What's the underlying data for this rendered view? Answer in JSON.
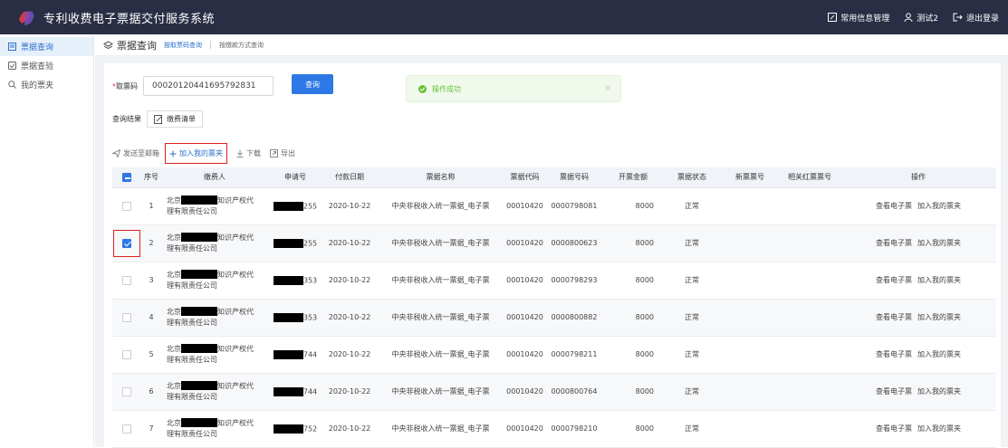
{
  "app": {
    "title": "专利收费电子票据交付服务系统"
  },
  "topnav": {
    "info_mgmt": "常用信息管理",
    "user": "测试2",
    "logout": "退出登录"
  },
  "sidebar": {
    "items": [
      {
        "label": "票据查询"
      },
      {
        "label": "票据查验"
      },
      {
        "label": "我的票夹"
      }
    ]
  },
  "tabs": {
    "title": "票据查询",
    "tab1": "按取票码查询",
    "sep": "|",
    "tab2": "按缴款方式查询"
  },
  "form": {
    "label": "取票码",
    "required_mark": "*",
    "code_value": "00020120441695792831",
    "query_button": "查询"
  },
  "toast": {
    "message": "操作成功",
    "close": "×"
  },
  "result": {
    "label": "查询结果",
    "tab": "缴费清单"
  },
  "toolbar": {
    "send_email": "发送至邮箱",
    "add_to_folder": "加入我的票夹",
    "download": "下载",
    "export": "导出"
  },
  "table": {
    "headers": [
      "序号",
      "缴费人",
      "申请号",
      "付款日期",
      "票据名称",
      "票据代码",
      "票据号码",
      "开票金额",
      "票据状态",
      "新票票号",
      "相关红票票号",
      "操作"
    ],
    "rows": [
      {
        "no": "1",
        "payer_prefix": "北京",
        "payer_suffix": "知识产权代",
        "payer_line2": "理有限责任公司",
        "app_suffix": "255",
        "date": "2020-10-22",
        "name": "中央非税收入统一票据_电子票",
        "code": "00010420",
        "number": "0000798081",
        "amount": "8000",
        "status": "正常",
        "new_no": "",
        "red_no": "",
        "op_view": "查看电子票",
        "op_add": "加入我的票夹",
        "checked": false
      },
      {
        "no": "2",
        "payer_prefix": "北京",
        "payer_suffix": "知识产权代",
        "payer_line2": "理有限责任公司",
        "app_suffix": "255",
        "date": "2020-10-22",
        "name": "中央非税收入统一票据_电子票",
        "code": "00010420",
        "number": "0000800623",
        "amount": "8000",
        "status": "正常",
        "new_no": "",
        "red_no": "",
        "op_view": "查看电子票",
        "op_add": "加入我的票夹",
        "checked": true
      },
      {
        "no": "3",
        "payer_prefix": "北京",
        "payer_suffix": "知识产权代",
        "payer_line2": "理有限责任公司",
        "app_suffix": "353",
        "date": "2020-10-22",
        "name": "中央非税收入统一票据_电子票",
        "code": "00010420",
        "number": "0000798293",
        "amount": "8000",
        "status": "正常",
        "new_no": "",
        "red_no": "",
        "op_view": "查看电子票",
        "op_add": "加入我的票夹",
        "checked": false
      },
      {
        "no": "4",
        "payer_prefix": "北京",
        "payer_suffix": "知识产权代",
        "payer_line2": "理有限责任公司",
        "app_suffix": "353",
        "date": "2020-10-22",
        "name": "中央非税收入统一票据_电子票",
        "code": "00010420",
        "number": "0000800882",
        "amount": "8000",
        "status": "正常",
        "new_no": "",
        "red_no": "",
        "op_view": "查看电子票",
        "op_add": "加入我的票夹",
        "checked": false
      },
      {
        "no": "5",
        "payer_prefix": "北京",
        "payer_suffix": "知识产权代",
        "payer_line2": "理有限责任公司",
        "app_suffix": "744",
        "date": "2020-10-22",
        "name": "中央非税收入统一票据_电子票",
        "code": "00010420",
        "number": "0000798211",
        "amount": "8000",
        "status": "正常",
        "new_no": "",
        "red_no": "",
        "op_view": "查看电子票",
        "op_add": "加入我的票夹",
        "checked": false
      },
      {
        "no": "6",
        "payer_prefix": "北京",
        "payer_suffix": "知识产权代",
        "payer_line2": "理有限责任公司",
        "app_suffix": "744",
        "date": "2020-10-22",
        "name": "中央非税收入统一票据_电子票",
        "code": "00010420",
        "number": "0000800764",
        "amount": "8000",
        "status": "正常",
        "new_no": "",
        "red_no": "",
        "op_view": "查看电子票",
        "op_add": "加入我的票夹",
        "checked": false
      },
      {
        "no": "7",
        "payer_prefix": "北京",
        "payer_suffix": "知识产权代",
        "payer_line2": "理有限责任公司",
        "app_suffix": "752",
        "date": "2020-10-22",
        "name": "中央非税收入统一票据_电子票",
        "code": "00010420",
        "number": "0000798210",
        "amount": "8000",
        "status": "正常",
        "new_no": "",
        "red_no": "",
        "op_view": "查看电子票",
        "op_add": "加入我的票夹",
        "checked": false
      }
    ]
  },
  "colors": {
    "topbar": "#2a2e45",
    "primary": "#2d78e4",
    "success": "#67c23a",
    "highlight": "#e02020"
  }
}
